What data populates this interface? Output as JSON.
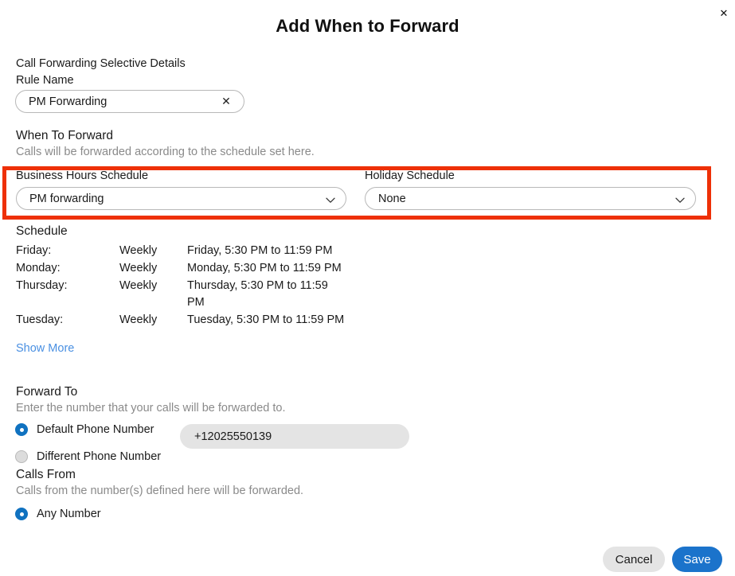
{
  "dialog": {
    "title": "Add When to Forward",
    "close_icon": "close-icon"
  },
  "details": {
    "section_label": "Call Forwarding Selective Details",
    "rule_name_label": "Rule Name",
    "rule_name_value": "PM Forwarding",
    "rule_name_placeholder": "Rule Name",
    "clear_icon": "✕"
  },
  "when_to_forward": {
    "heading": "When To Forward",
    "description": "Calls will be forwarded according to the schedule set here.",
    "business_hours": {
      "label": "Business Hours Schedule",
      "value": "PM forwarding"
    },
    "holiday": {
      "label": "Holiday Schedule",
      "value": "None"
    },
    "highlight_color": "#ee3007"
  },
  "schedule": {
    "heading": "Schedule",
    "rows": [
      {
        "day": "Friday:",
        "frequency": "Weekly",
        "detail": "Friday, 5:30 PM to 11:59 PM"
      },
      {
        "day": "Monday:",
        "frequency": "Weekly",
        "detail": "Monday, 5:30 PM to 11:59 PM"
      },
      {
        "day": "Thursday:",
        "frequency": "Weekly",
        "detail": "Thursday, 5:30 PM to 11:59 PM"
      },
      {
        "day": "Tuesday:",
        "frequency": "Weekly",
        "detail": "Tuesday, 5:30 PM to 11:59 PM"
      }
    ],
    "show_more_label": "Show More"
  },
  "forward_to": {
    "heading": "Forward To",
    "description": "Enter the number that your calls will be forwarded to.",
    "options": [
      {
        "label": "Default Phone Number",
        "selected": true
      },
      {
        "label": "Different Phone Number",
        "selected": false
      }
    ],
    "phone_number": "+12025550139"
  },
  "calls_from": {
    "heading": "Calls From",
    "description": "Calls from the number(s) defined here will be forwarded.",
    "options": [
      {
        "label": "Any Number",
        "selected": true
      }
    ]
  },
  "footer": {
    "cancel_label": "Cancel",
    "save_label": "Save",
    "save_color": "#1b73cb"
  }
}
